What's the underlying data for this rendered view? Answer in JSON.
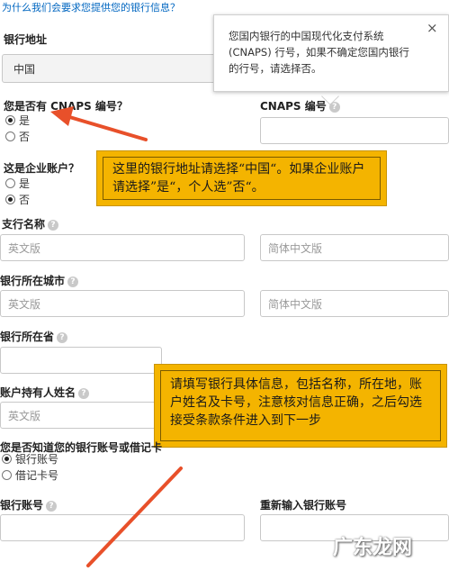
{
  "top_link": "为什么我们会要求您提供您的银行信息？",
  "bank_address": {
    "label": "银行地址",
    "value": "中国"
  },
  "tooltip": {
    "text": "您国内银行的中国现代化支付系统 (CNAPS) 行号，如果不确定您国内银行的行号，请选择否。",
    "close": "×"
  },
  "cnaps_question": {
    "label": "您是否有 CNAPS 编号？",
    "options": [
      "是",
      "否"
    ],
    "selected": 0
  },
  "cnaps_number": {
    "label": "CNAPS 编号"
  },
  "enterprise": {
    "label": "这是企业账户？",
    "options": [
      "是",
      "否"
    ],
    "selected": 1
  },
  "note1": "这里的银行地址请选择“中国“。如果企业账户请选择”是“，个人选”否“。",
  "branch": {
    "label": "支行名称",
    "placeholder_en": "英文版",
    "placeholder_cn": "简体中文版"
  },
  "city": {
    "label": "银行所在城市",
    "placeholder_en": "英文版",
    "placeholder_cn": "简体中文版"
  },
  "province": {
    "label": "银行所在省"
  },
  "holder": {
    "label": "账户持有人姓名",
    "placeholder_en": "英文版"
  },
  "note2": "请填写银行具体信息，包括名称，所在地，账户姓名及卡号，注意核对信息正确，之后勾选接受条款条件进入到下一步",
  "account_type": {
    "label": "您是否知道您的银行账号或借记卡",
    "options": [
      "银行账号",
      "借记卡号"
    ],
    "selected": 0
  },
  "account_number": {
    "label": "银行账号"
  },
  "account_number_confirm": {
    "label": "重新输入银行账号"
  },
  "watermark": "广东龙网",
  "colors": {
    "note_bg": "#f4b400",
    "arrow": "#e8502a",
    "link": "#0066c0"
  }
}
